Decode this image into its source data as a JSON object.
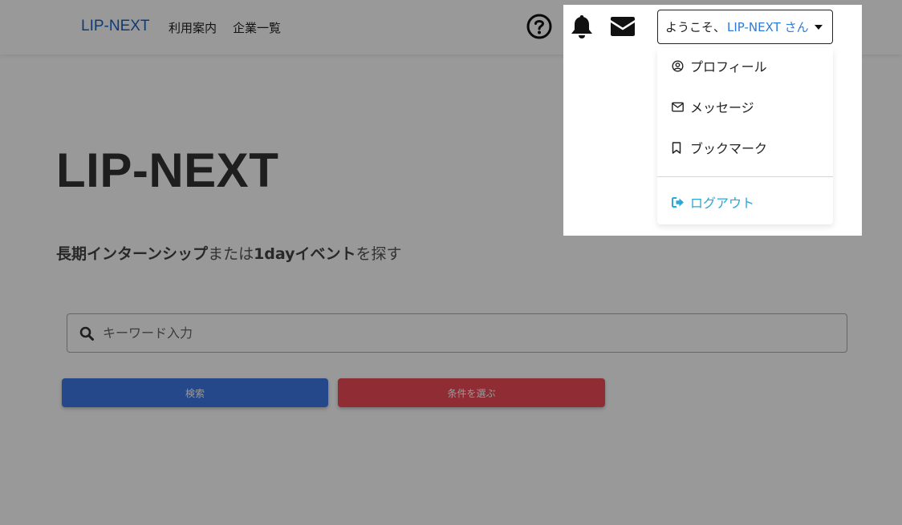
{
  "navbar": {
    "brand": "LIP-NEXT",
    "links": [
      "利用案内",
      "企業一覧"
    ],
    "icons": [
      "help-circle-icon",
      "bell-icon",
      "envelope-icon"
    ],
    "user_menu": {
      "greeting": "ようこそ、",
      "username": "LIP-NEXT さん",
      "items": [
        {
          "label": "プロフィール",
          "icon": "user-circle-icon"
        },
        {
          "label": "メッセージ",
          "icon": "envelope-outline-icon"
        },
        {
          "label": "ブックマーク",
          "icon": "bookmark-icon"
        }
      ],
      "logout": {
        "label": "ログアウト",
        "icon": "sign-out-icon"
      }
    }
  },
  "hero": {
    "title": "LIP-NEXT",
    "subtitle": {
      "part1": "長期インターンシップ",
      "part2": "または",
      "part3": "1dayイベント",
      "part4": "を探す"
    }
  },
  "search": {
    "placeholder": "キーワード入力",
    "value": "",
    "search_button": "検索",
    "filter_button": "条件を選ぶ"
  },
  "colors": {
    "brand": "#1a63c4",
    "username": "#2d7bd4",
    "search_button": "#3d78e6",
    "filter_button": "#f04a56",
    "logout": "#2aa8d8",
    "overlay": "rgba(0,0,0,0.40)"
  }
}
